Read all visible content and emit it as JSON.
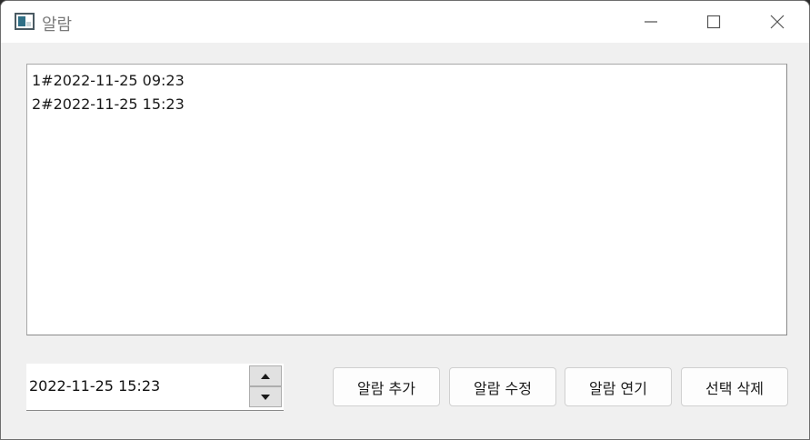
{
  "window": {
    "title": "알람",
    "icon": "app-window-icon",
    "controls": [
      "minimize-icon",
      "maximize-icon",
      "close-icon"
    ]
  },
  "alarm_list": {
    "items": [
      "1#2022-11-25 09:23",
      "2#2022-11-25 15:23"
    ]
  },
  "datetime_edit": {
    "value": "2022-11-25 15:23",
    "up_icon": "arrow-up-icon",
    "down_icon": "arrow-down-icon"
  },
  "buttons": {
    "add": "알람 추가",
    "edit": "알람 수정",
    "delay": "알람 연기",
    "delete": "선택 삭제"
  }
}
